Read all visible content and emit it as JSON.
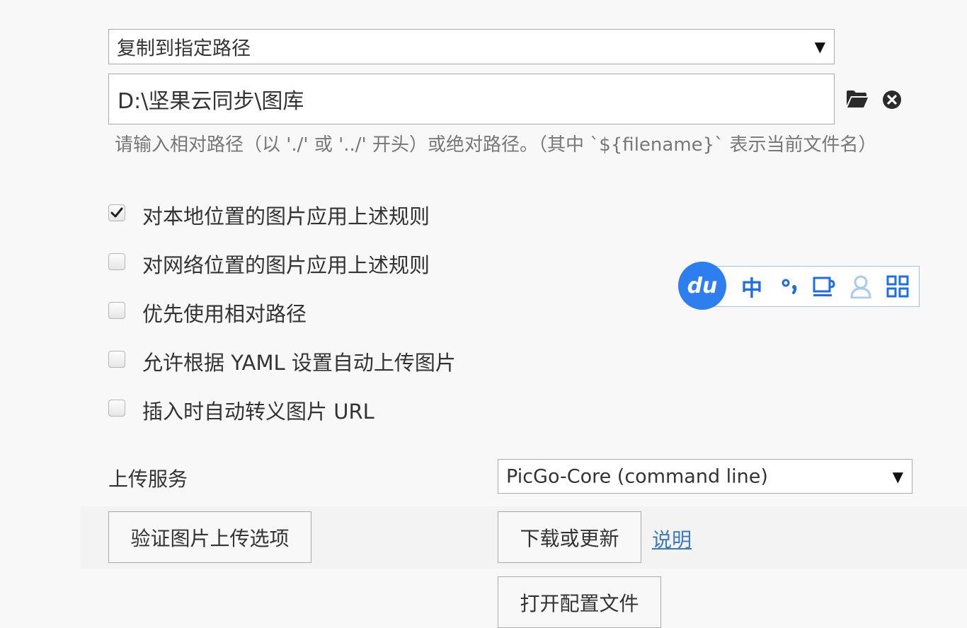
{
  "action_select": {
    "value": "复制到指定路径"
  },
  "path": {
    "value": "D:\\坚果云同步\\图库",
    "hint": "请输入相对路径（以 './' 或 '../' 开头）或绝对路径。（其中 `${filename}` 表示当前文件名）"
  },
  "options": [
    {
      "label": "对本地位置的图片应用上述规则",
      "checked": true
    },
    {
      "label": "对网络位置的图片应用上述规则",
      "checked": false
    },
    {
      "label": "优先使用相对路径",
      "checked": false
    },
    {
      "label": "允许根据 YAML 设置自动上传图片",
      "checked": false
    },
    {
      "label": "插入时自动转义图片 URL",
      "checked": false
    }
  ],
  "upload": {
    "label": "上传服务",
    "service_value": "PicGo-Core (command line)",
    "verify_button": "验证图片上传选项",
    "download_button": "下载或更新",
    "help_link": "说明",
    "open_config_button": "打开配置文件"
  },
  "ime": {
    "logo": "du",
    "lang": "中"
  },
  "icons": {
    "folder": "folder-open-icon",
    "clear": "close-circle-icon",
    "checkmark": "checkmark-icon",
    "dropdown": "triangle-down-icon"
  }
}
